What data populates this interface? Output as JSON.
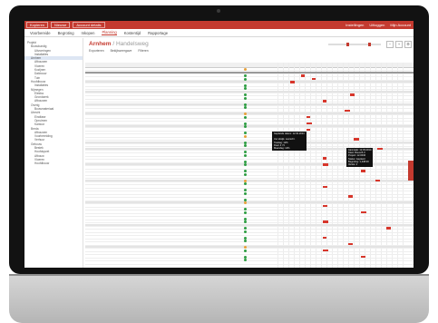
{
  "topbar": {
    "left_items": [
      "Kopieren",
      "Nieuwe",
      "Account details"
    ],
    "right_items": [
      "Instellingen",
      "Uitloggen",
      "Mijn Account"
    ]
  },
  "nav": {
    "tabs": [
      "Voorbereide",
      "Begroting",
      "Inkopen",
      "Planning",
      "Kostentijd",
      "Rapportage"
    ],
    "active": 3
  },
  "sidebar": {
    "items": [
      "Projekt",
      "Bouwkundig",
      "Uitvoeringen",
      "Installaties",
      "Arnhem",
      "Afbouwen",
      "Vloeren",
      "Kozijnen",
      "Dakbouw",
      "Tuin",
      "Hoofdbouw",
      "Installaties",
      "Nijmegen",
      "Elektra",
      "Grondwerk",
      "Afbouwen",
      "Overig",
      "Bouwmateriaal",
      "Utrecht",
      "Eindfase",
      "Opruimen",
      "Kantoor",
      "Breda",
      "Afbouwen",
      "Voorbereiding",
      "Verhuur",
      "Gebouw",
      "Bestek",
      "Hoofdopzet",
      "Afbouw",
      "Vloeren",
      "Hoofdbouw"
    ],
    "selected_index": 4
  },
  "page": {
    "title": "Arnhem",
    "subtitle": " / Handelsweg",
    "tools": [
      "Exporteren",
      "Bekijkweergave",
      "Filteren"
    ]
  },
  "tips": [
    "Geplande datum: 12.03.2014\n\nUur afwijk. overschr.\nToeslag: 12%\nDoel: 4 / 5\nMaandag: 12%",
    "Aanmaak: 12.03.2014\nKlant: Bouw B.V.\nProject: 12-0046\nStatus: Gepland\nBegroting: 1,248.00\nVersie: 2"
  ],
  "colors": {
    "accent": "#c43a2f",
    "bar": "#d7362b",
    "status_green": "#2e9e43",
    "status_orange": "#e8a13a"
  }
}
